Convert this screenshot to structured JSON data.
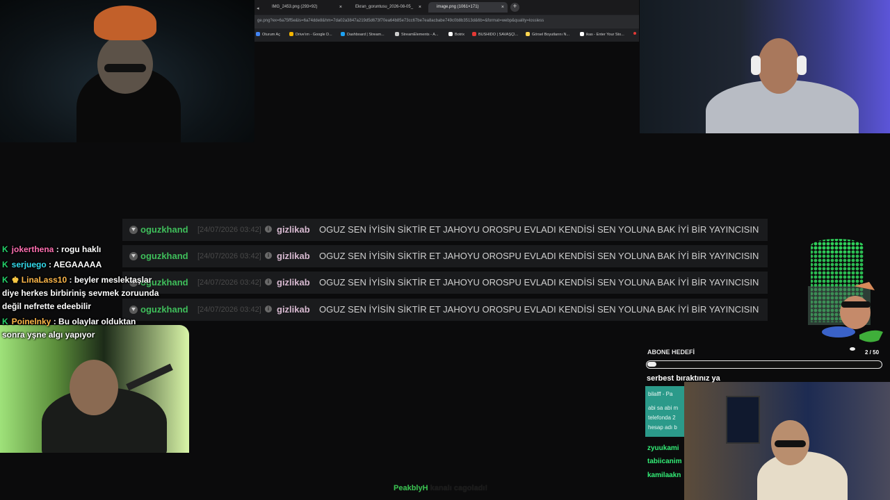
{
  "browser": {
    "tabs": [
      {
        "label": "IMG_2453.png (293×92)"
      },
      {
        "label": "Ekran_goruntusu_2026-08-05_"
      },
      {
        "label": "image.png (1061×171)"
      }
    ],
    "new_tab_symbol": "+",
    "close_symbol": "×",
    "url": "ge.png?ex=6a75ff5e&is=6a74dde8&hm=7da02a3847a219d5d673f70ea64b85e73cc67be7ea8acbabe749c0b8b3513d&6b=&format=webp&quality=lossless",
    "bookmarks": [
      {
        "label": "Oturum Aç",
        "color": "#4285f4"
      },
      {
        "label": "Drive'ım - Google D...",
        "color": "#f4b400"
      },
      {
        "label": "Dashboard | Stream...",
        "color": "#1da1f2"
      },
      {
        "label": "StreamElements - A...",
        "color": "#cccccc"
      },
      {
        "label": "Botrix",
        "color": "#ffffff"
      },
      {
        "label": "BUSHIDO | SAVAŞÇI...",
        "color": "#e53935"
      },
      {
        "label": "Görsel Boyutlarını N...",
        "color": "#ffd54f"
      },
      {
        "label": "ikas - Enter Your Sto...",
        "color": "#ffffff"
      }
    ]
  },
  "chat_rows": [
    {
      "user": "oguzkhand",
      "time": "[24/07/2026 03:42]",
      "target": "gizlikab",
      "message": "OGUZ SEN İYİSİN SİKTİR ET JAHOYU OROSPU EVLADI KENDİSİ SEN YOLUNA BAK İYİ BİR YAYINCISIN"
    },
    {
      "user": "oguzkhand",
      "time": "[24/07/2026 03:42]",
      "target": "gizlikab",
      "message": "OGUZ SEN İYİSİN SİKTİR ET JAHOYU OROSPU EVLADI KENDİSİ SEN YOLUNA BAK İYİ BİR YAYINCISIN"
    },
    {
      "user": "oguzkhand",
      "time": "[24/07/2026 03:42]",
      "target": "gizlikab",
      "message": "OGUZ SEN İYİSİN SİKTİR ET JAHOYU OROSPU EVLADI KENDİSİ SEN YOLUNA BAK İYİ BİR YAYINCISIN"
    },
    {
      "user": "oguzkhand",
      "time": "[24/07/2026 03:42]",
      "target": "gizlikab",
      "message": "OGUZ SEN İYİSİN SİKTİR ET JAHOYU OROSPU EVLADI KENDİSİ SEN YOLUNA BAK İYİ BİR YAYINCISIN"
    }
  ],
  "left_chat": [
    {
      "user": "jokerthena",
      "color": "#ff6fb1",
      "text": ": rogu haklı"
    },
    {
      "user": "serjuego",
      "color": "#33ddee",
      "text": ": AEGAAAAA"
    },
    {
      "user": "LinaLass10",
      "color": "#ffb84a",
      "text": ": beyler meslektaşlar"
    },
    {
      "user": "",
      "color": "#ffffff",
      "text": "diye herkes birbiriniş sevmek zoruunda"
    },
    {
      "user": "",
      "color": "#ffffff",
      "text": "değil nefrette edeebilir"
    },
    {
      "user": "Poinelnky",
      "color": "#ffb84a",
      "text": ": Bu olaylar olduktan"
    },
    {
      "user": "",
      "color": "#ffffff",
      "text": "sonra yşne algı yapıyor"
    }
  ],
  "badge_symbol": "K",
  "sub_goal": {
    "label": "ABONE HEDEFİ",
    "count": "2 / 50",
    "progress": 0.04,
    "caption": "serbest bıraktınız ya"
  },
  "side_panel": {
    "lines": [
      "bilalff - Pa",
      "abi sa abi m",
      "telefonda 2",
      "hesap adı b"
    ],
    "names": [
      "zyuukami",
      "tabiicanim",
      "kamilaakn"
    ]
  },
  "footer": {
    "name": "PeakblyH",
    "text": "kanalı cagoladı!"
  },
  "colors": {
    "username_green": "#3fbf5b",
    "target_pink": "#d7b9d0",
    "badge_green": "#24d36a"
  }
}
